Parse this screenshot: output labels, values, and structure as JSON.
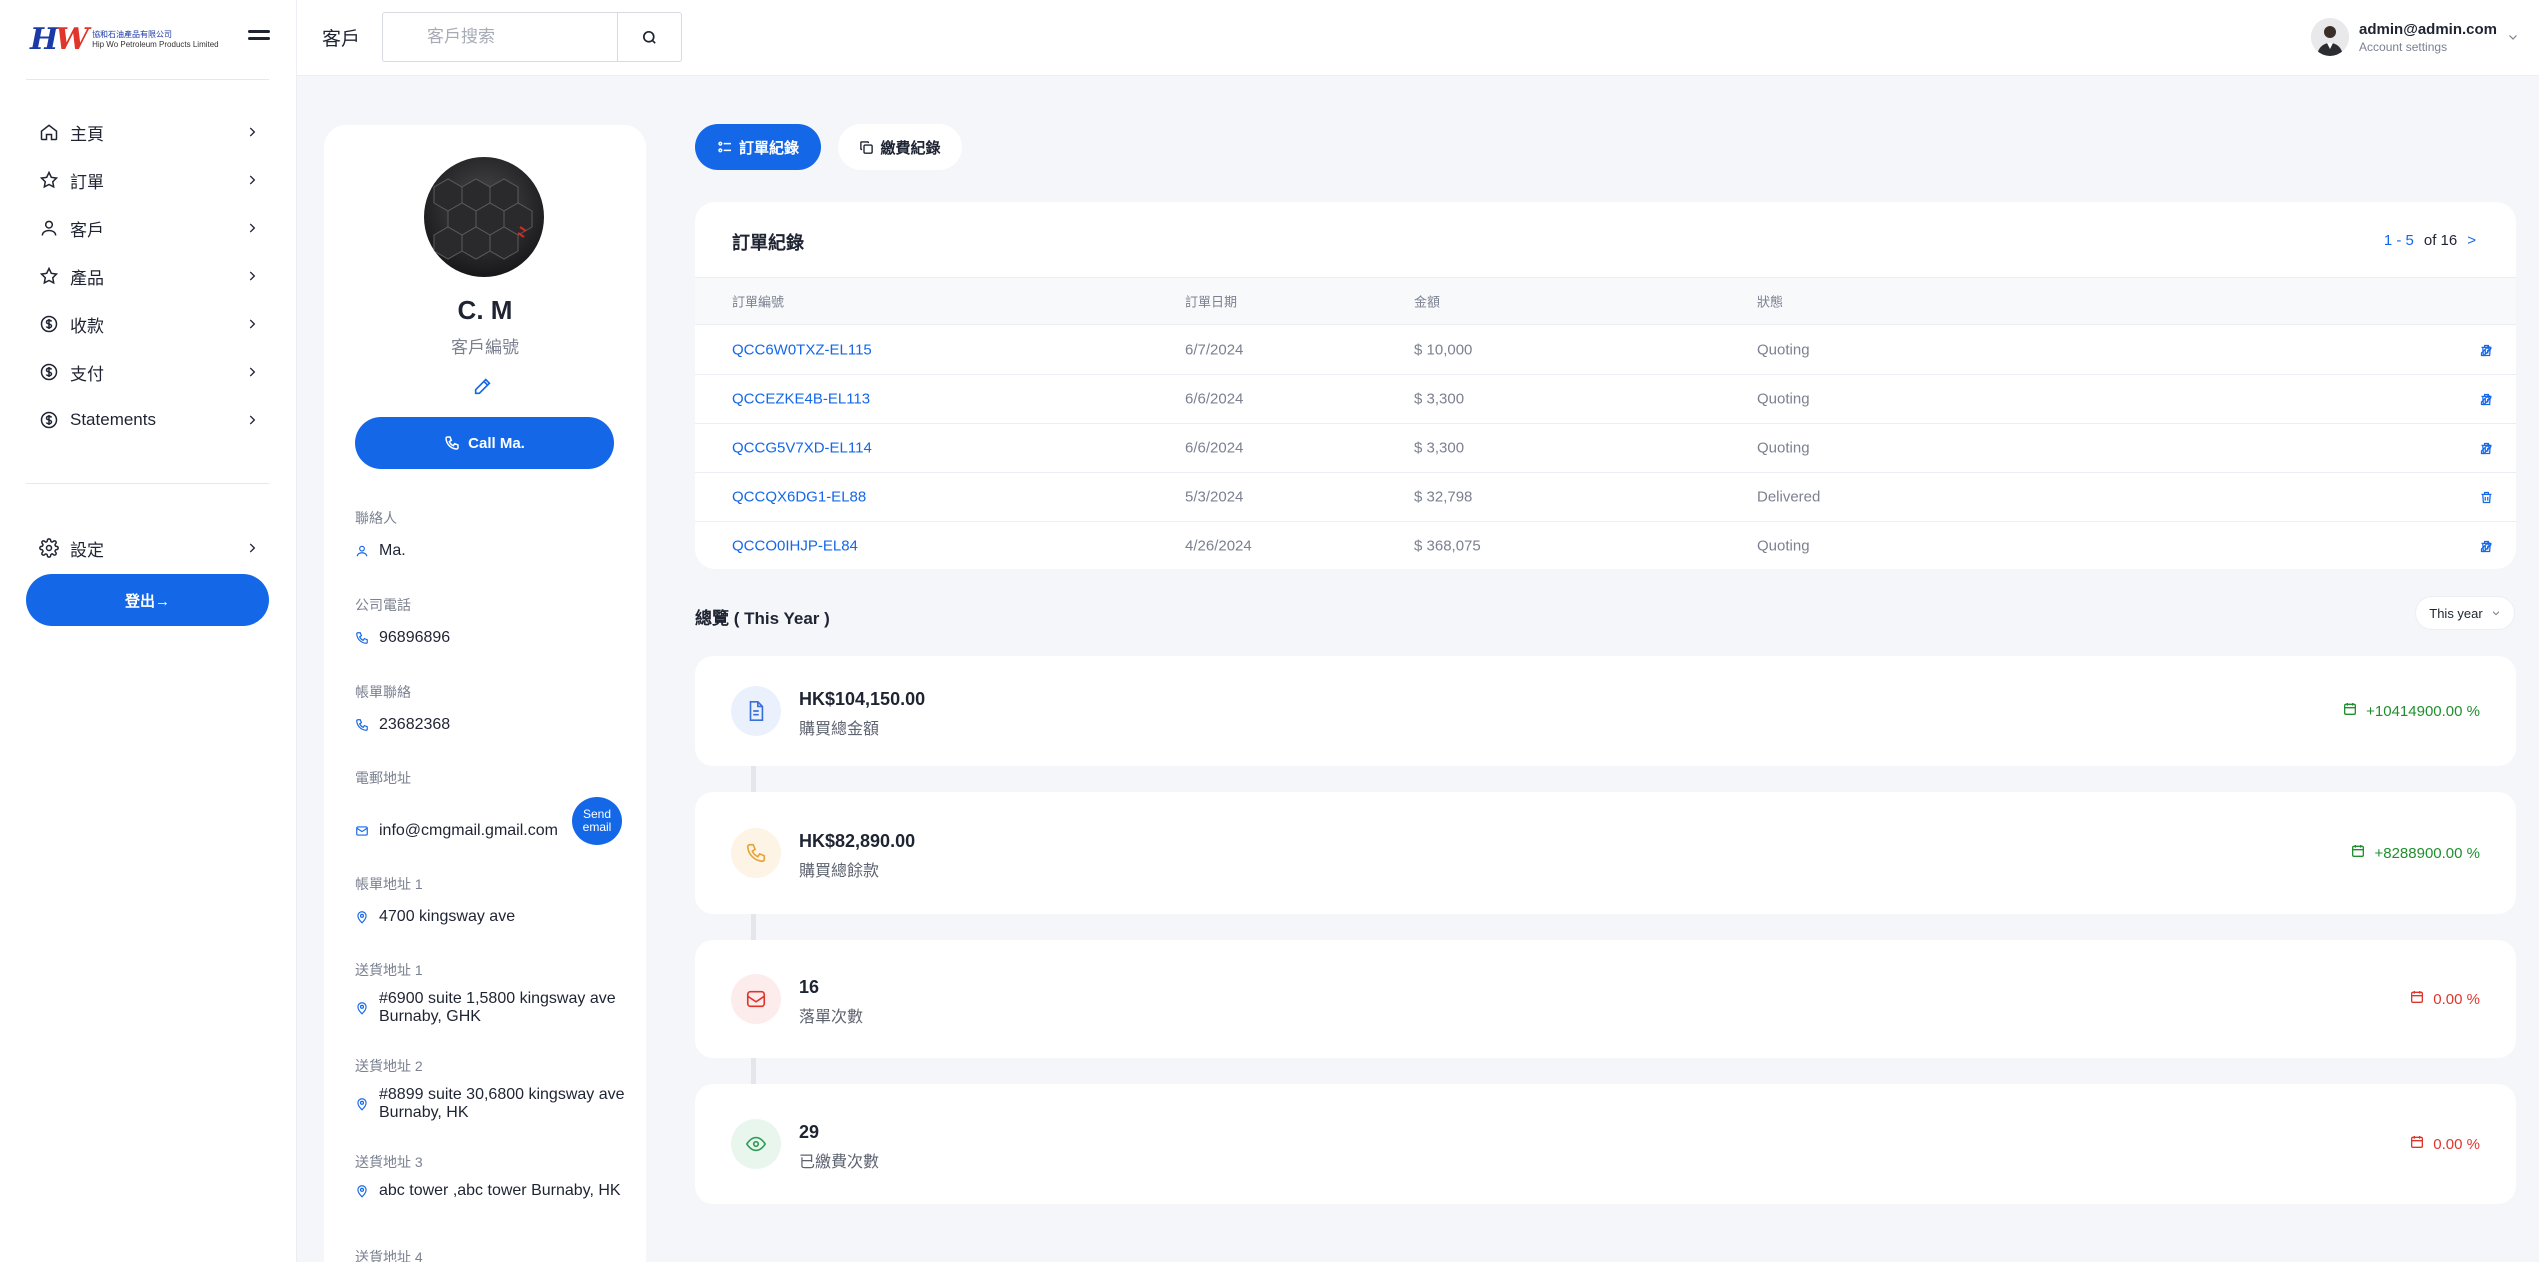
{
  "brand": {
    "mark_main": "HW",
    "name_zh": "協和石油產品有限公司",
    "name_en": "Hip Wo Petroleum Products Limited"
  },
  "sidebar": {
    "items": [
      {
        "label": "主頁",
        "icon": "home-icon"
      },
      {
        "label": "訂單",
        "icon": "star-icon"
      },
      {
        "label": "客戶",
        "icon": "user-icon"
      },
      {
        "label": "產品",
        "icon": "star-icon"
      },
      {
        "label": "收款",
        "icon": "dollar-circle-icon"
      },
      {
        "label": "支付",
        "icon": "dollar-circle-icon"
      },
      {
        "label": "Statements",
        "icon": "dollar-circle-icon"
      }
    ],
    "settings_label": "設定",
    "logout_label": "登出→"
  },
  "header": {
    "title": "客戶",
    "search_placeholder": "客戶搜索",
    "account_email": "admin@admin.com",
    "account_sub": "Account settings"
  },
  "profile": {
    "name": "C. M",
    "id_label": "客戶編號",
    "call_label": "Call Ma.",
    "send_email_label": "Send email",
    "fields": {
      "contact": {
        "label": "聯絡人",
        "value": "Ma."
      },
      "company_phone": {
        "label": "公司電話",
        "value": "96896896"
      },
      "billing_contact": {
        "label": "帳單聯絡",
        "value": "23682368"
      },
      "email": {
        "label": "電郵地址",
        "value": "info@cmgmail.gmail.com"
      },
      "billing_address": {
        "label": "帳單地址 1",
        "value": "4700 kingsway ave"
      },
      "ship1": {
        "label": "送貨地址 1",
        "value": "#6900 suite 1,5800 kingsway ave Burnaby, GHK"
      },
      "ship2": {
        "label": "送貨地址 2",
        "value": "#8899 suite 30,6800 kingsway ave Burnaby, HK"
      },
      "ship3": {
        "label": "送貨地址 3",
        "value": "abc tower ,abc tower Burnaby, HK"
      },
      "ship4": {
        "label": "送貨地址 4",
        "value": ""
      }
    }
  },
  "tabs": {
    "orders_label": "訂單紀錄",
    "payments_label": "繳費紀錄"
  },
  "orders": {
    "title": "訂單紀錄",
    "pager_range": "1 - 5",
    "pager_total": "of 16",
    "pager_next": ">",
    "columns": [
      "訂單編號",
      "訂單日期",
      "金額",
      "狀態"
    ],
    "rows": [
      {
        "id": "QCC6W0TXZ-EL115",
        "date": "6/7/2024",
        "amount": "$ 10,000",
        "status": "Quoting",
        "editable": true
      },
      {
        "id": "QCCEZKE4B-EL113",
        "date": "6/6/2024",
        "amount": "$ 3,300",
        "status": "Quoting",
        "editable": true
      },
      {
        "id": "QCCG5V7XD-EL114",
        "date": "6/6/2024",
        "amount": "$ 3,300",
        "status": "Quoting",
        "editable": true
      },
      {
        "id": "QCCQX6DG1-EL88",
        "date": "5/3/2024",
        "amount": "$ 32,798",
        "status": "Delivered",
        "editable": false
      },
      {
        "id": "QCCO0IHJP-EL84",
        "date": "4/26/2024",
        "amount": "$ 368,075",
        "status": "Quoting",
        "editable": true
      }
    ]
  },
  "overview": {
    "title": "總覽 ( This Year )",
    "period": "This year",
    "stats": [
      {
        "value": "HK$104,150.00",
        "label": "購買總金額",
        "pct": "+10414900.00 %",
        "trend": "up",
        "icon": "document-icon",
        "icon_color": "#3b6fd8",
        "bg": "#eaf1fd"
      },
      {
        "value": "HK$82,890.00",
        "label": "購買總餘款",
        "pct": "+8288900.00 %",
        "trend": "up",
        "icon": "phone-icon",
        "icon_color": "#e8a33a",
        "bg": "#fdf4e6"
      },
      {
        "value": "16",
        "label": "落單次數",
        "pct": "0.00 %",
        "trend": "down",
        "icon": "inbox-icon",
        "icon_color": "#e0352b",
        "bg": "#fdecec"
      },
      {
        "value": "29",
        "label": "已繳費次數",
        "pct": "0.00 %",
        "trend": "down",
        "icon": "eye-icon",
        "icon_color": "#2e9d55",
        "bg": "#e8f6ee"
      }
    ]
  },
  "colors": {
    "accent": "#1468e8",
    "positive": "#1f8f2e",
    "negative": "#e0352b"
  }
}
